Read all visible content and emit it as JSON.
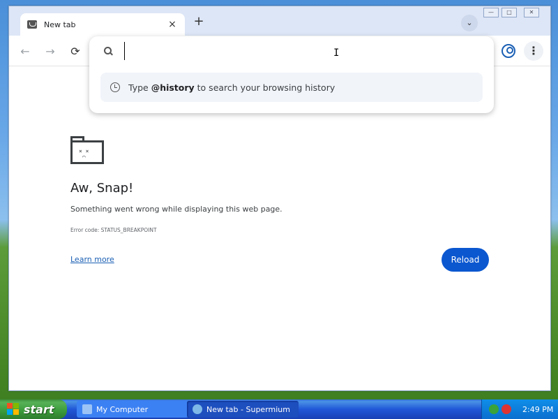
{
  "browser": {
    "tab_title": "New tab",
    "tab_close": "×",
    "new_tab": "+",
    "tab_search": "⌄",
    "win_min": "—",
    "win_max": "□",
    "win_close": "✕",
    "nav_back": "←",
    "nav_forward": "→",
    "nav_reload": "⟳",
    "menu": "⋮"
  },
  "omnibox": {
    "input_value": "",
    "suggestion_prefix": "Type ",
    "suggestion_keyword": "@history",
    "suggestion_suffix": " to search your browsing history"
  },
  "error_page": {
    "sad_face": "× ×\n ⌒",
    "heading": "Aw, Snap!",
    "message": "Something went wrong while displaying this web page.",
    "error_code": "Error code: STATUS_BREAKPOINT",
    "learn_more": "Learn more",
    "reload": "Reload"
  },
  "taskbar": {
    "start": "start",
    "items": [
      {
        "label": "My Computer"
      },
      {
        "label": "New tab - Supermium"
      }
    ],
    "clock": "2:49 PM"
  },
  "colors": {
    "accent": "#0b57d0",
    "link": "#1a5fb4"
  }
}
